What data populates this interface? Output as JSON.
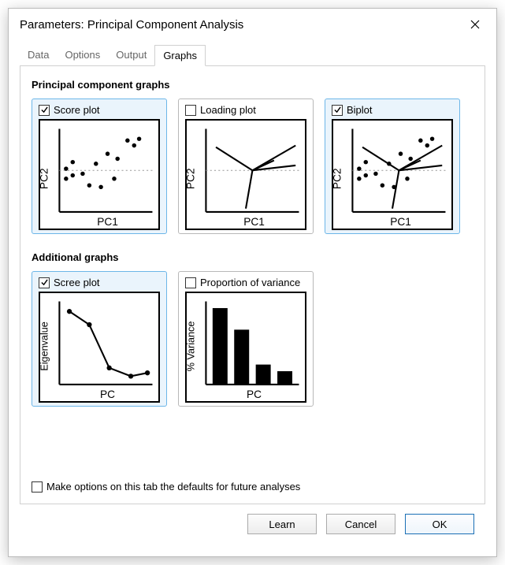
{
  "window": {
    "title": "Parameters: Principal Component Analysis"
  },
  "tabs": [
    "Data",
    "Options",
    "Output",
    "Graphs"
  ],
  "active_tab": 3,
  "sections": {
    "principal": "Principal component graphs",
    "additional": "Additional graphs"
  },
  "graphs": {
    "score": {
      "label": "Score plot",
      "checked": true,
      "xlabel": "PC1",
      "ylabel": "PC2"
    },
    "loading": {
      "label": "Loading plot",
      "checked": false,
      "xlabel": "PC1",
      "ylabel": "PC2"
    },
    "biplot": {
      "label": "Biplot",
      "checked": true,
      "xlabel": "PC1",
      "ylabel": "PC2"
    },
    "scree": {
      "label": "Scree plot",
      "checked": true,
      "xlabel": "PC",
      "ylabel": "Eigenvalue"
    },
    "variance": {
      "label": "Proportion of variance",
      "checked": false,
      "xlabel": "PC",
      "ylabel": "% Variance"
    }
  },
  "defaults_label": "Make options on this tab the defaults for future analyses",
  "defaults_checked": false,
  "buttons": {
    "learn": "Learn",
    "cancel": "Cancel",
    "ok": "OK"
  }
}
